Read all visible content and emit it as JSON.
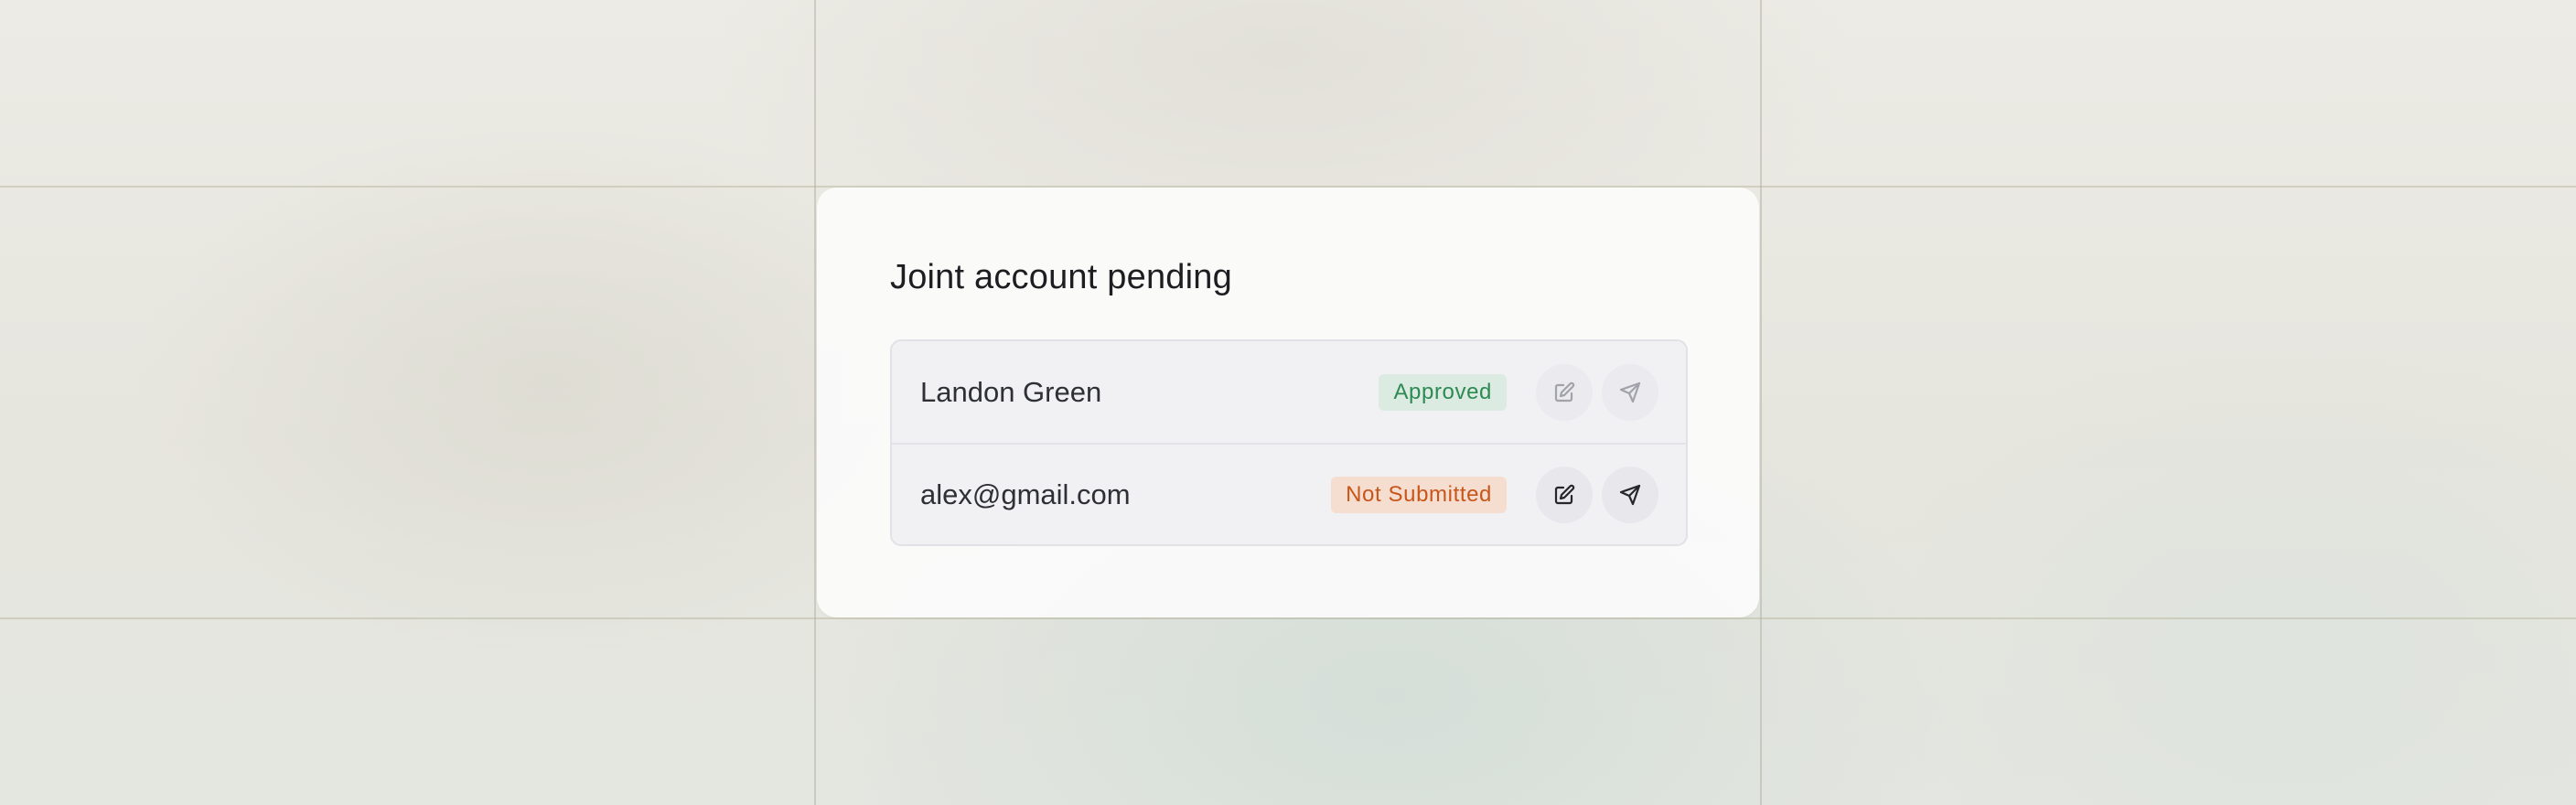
{
  "card": {
    "title": "Joint account pending"
  },
  "members": [
    {
      "name": "Landon Green",
      "status": "Approved",
      "status_color": "#2c8a52",
      "actions_enabled": false,
      "edit_icon": "pencil-square-icon",
      "send_icon": "paper-plane-icon"
    },
    {
      "name": "alex@gmail.com",
      "status": "Not Submitted",
      "status_color": "#c8561a",
      "actions_enabled": true,
      "edit_icon": "pencil-square-icon",
      "send_icon": "paper-plane-icon"
    }
  ]
}
